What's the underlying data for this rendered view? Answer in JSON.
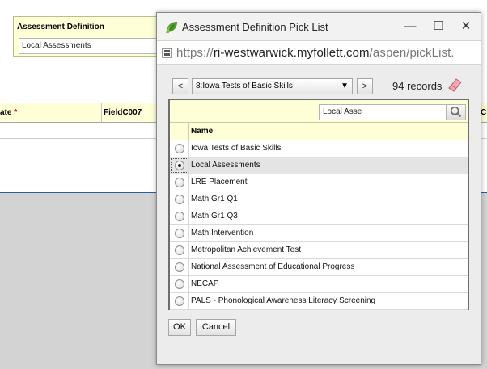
{
  "background": {
    "assessment_definition": {
      "label": "Assessment Definition",
      "value": "Local Assessments"
    },
    "grid": {
      "columns": [
        {
          "label": "ate",
          "required_mark": "*"
        },
        {
          "label": "FieldC007",
          "required_mark": ""
        },
        {
          "label": "C",
          "required_mark": ""
        }
      ]
    }
  },
  "dialog": {
    "title": "Assessment Definition Pick List",
    "window_controls": {
      "minimize": "—",
      "maximize": "☐",
      "close": "✕"
    },
    "url": {
      "scheme": "https://",
      "host": "ri-westwarwick.myfollett.com",
      "path": "/aspen/pickList."
    },
    "navigator": {
      "prev": "<",
      "next": ">",
      "selected": "8:Iowa Tests of Basic Skills",
      "arrow": "▼",
      "records": "94 records"
    },
    "search": {
      "value": "Local Asse"
    },
    "table": {
      "header": "Name",
      "rows": [
        {
          "name": "Iowa Tests of Basic Skills",
          "selected": false
        },
        {
          "name": "Local Assessments",
          "selected": true
        },
        {
          "name": "LRE Placement",
          "selected": false
        },
        {
          "name": "Math Gr1 Q1",
          "selected": false
        },
        {
          "name": "Math Gr1 Q3",
          "selected": false
        },
        {
          "name": "Math Intervention",
          "selected": false
        },
        {
          "name": "Metropolitan Achievement Test",
          "selected": false
        },
        {
          "name": "National Assessment of Educational Progress",
          "selected": false
        },
        {
          "name": "NECAP",
          "selected": false
        },
        {
          "name": "PALS - Phonological Awareness Literacy Screening",
          "selected": false
        }
      ]
    },
    "buttons": {
      "ok": "OK",
      "cancel": "Cancel"
    }
  },
  "colors": {
    "highlight_yellow": "#ffffd7",
    "selected_row": "#e4e4e4",
    "leaf_green": "#4f9a2a",
    "eraser_pink": "#f3a6b3"
  }
}
